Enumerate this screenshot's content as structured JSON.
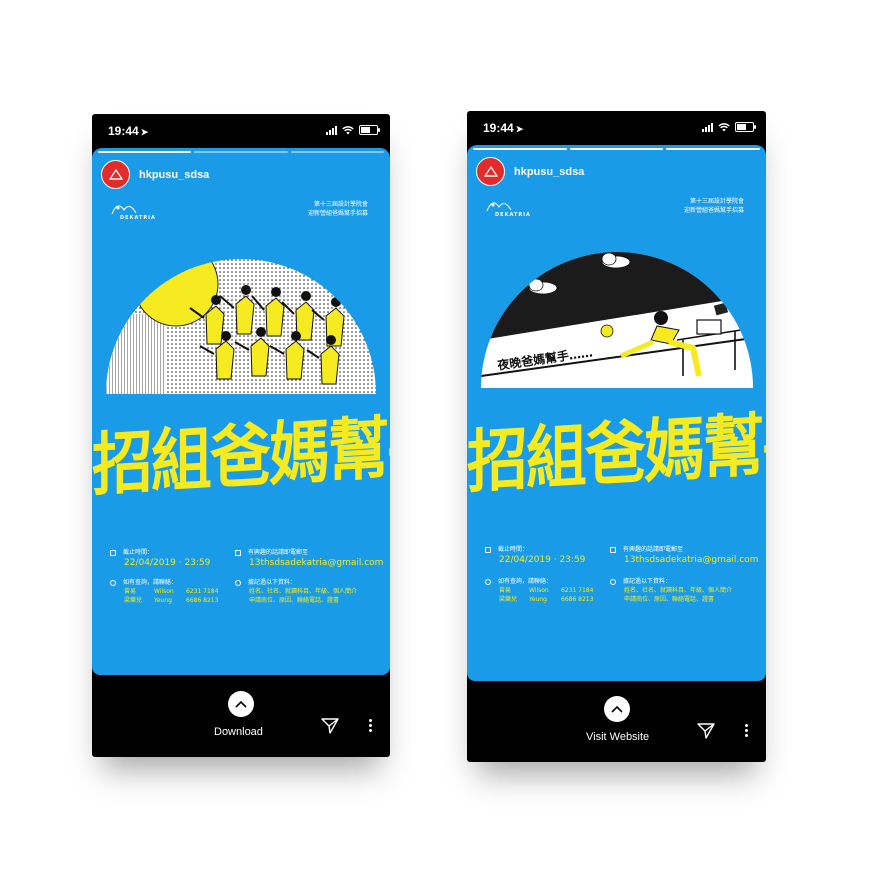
{
  "colors": {
    "story_blue": "#1a9be8",
    "headline_yellow": "#f6ea20",
    "avatar_red": "#e42b2b"
  },
  "left": {
    "status": {
      "time": "19:44"
    },
    "username": "hkpusu_sdsa",
    "brand": "DEKATRIA",
    "org_line1": "第十三屆設計學院會",
    "org_line2": "迎新營組爸媽幫手招募",
    "headline": "招組爸媽幫手",
    "deadline_label": "截止時間：",
    "deadline": "22/04/2019 · 23:59",
    "email_label": "有興趣的話請即電郵至",
    "email": "13thsdsadekatria@gmail.com",
    "enquiry_label": "如有查詢，請聯絡：",
    "contacts": [
      {
        "name": "曾易",
        "en": "Wilson",
        "phone": "6231 7184"
      },
      {
        "name": "梁樂兒",
        "en": "Yeung",
        "phone": "6686 8213"
      }
    ],
    "fill_label": "據記過以下資料：",
    "fill_line1": "姓名、社名、就讀科目、年級、個人簡介",
    "fill_line2": "申請崗位、原因、聯絡電話、證書",
    "cta_label": "Download"
  },
  "right": {
    "status": {
      "time": "19:44"
    },
    "username": "hkpusu_sdsa",
    "brand": "DEKATRIA",
    "org_line1": "第十三屆設計學院會",
    "org_line2": "迎新營組爸媽幫手招募",
    "tagline": "夜晚爸媽幫手……",
    "headline": "招組爸媽幫手",
    "deadline_label": "截止時間：",
    "deadline": "22/04/2019 · 23:59",
    "email_label": "有興趣的話請即電郵至",
    "email": "13thsdsadekatria@gmail.com",
    "enquiry_label": "如有查詢，請聯絡：",
    "contacts": [
      {
        "name": "曾易",
        "en": "Wilson",
        "phone": "6231 7184"
      },
      {
        "name": "梁樂兒",
        "en": "Yeung",
        "phone": "6686 8213"
      }
    ],
    "fill_label": "據記過以下資料：",
    "fill_line1": "姓名、社名、就讀科目、年級、個人簡介",
    "fill_line2": "申請崗位、原因、聯絡電話、證書",
    "cta_label": "Visit Website"
  }
}
